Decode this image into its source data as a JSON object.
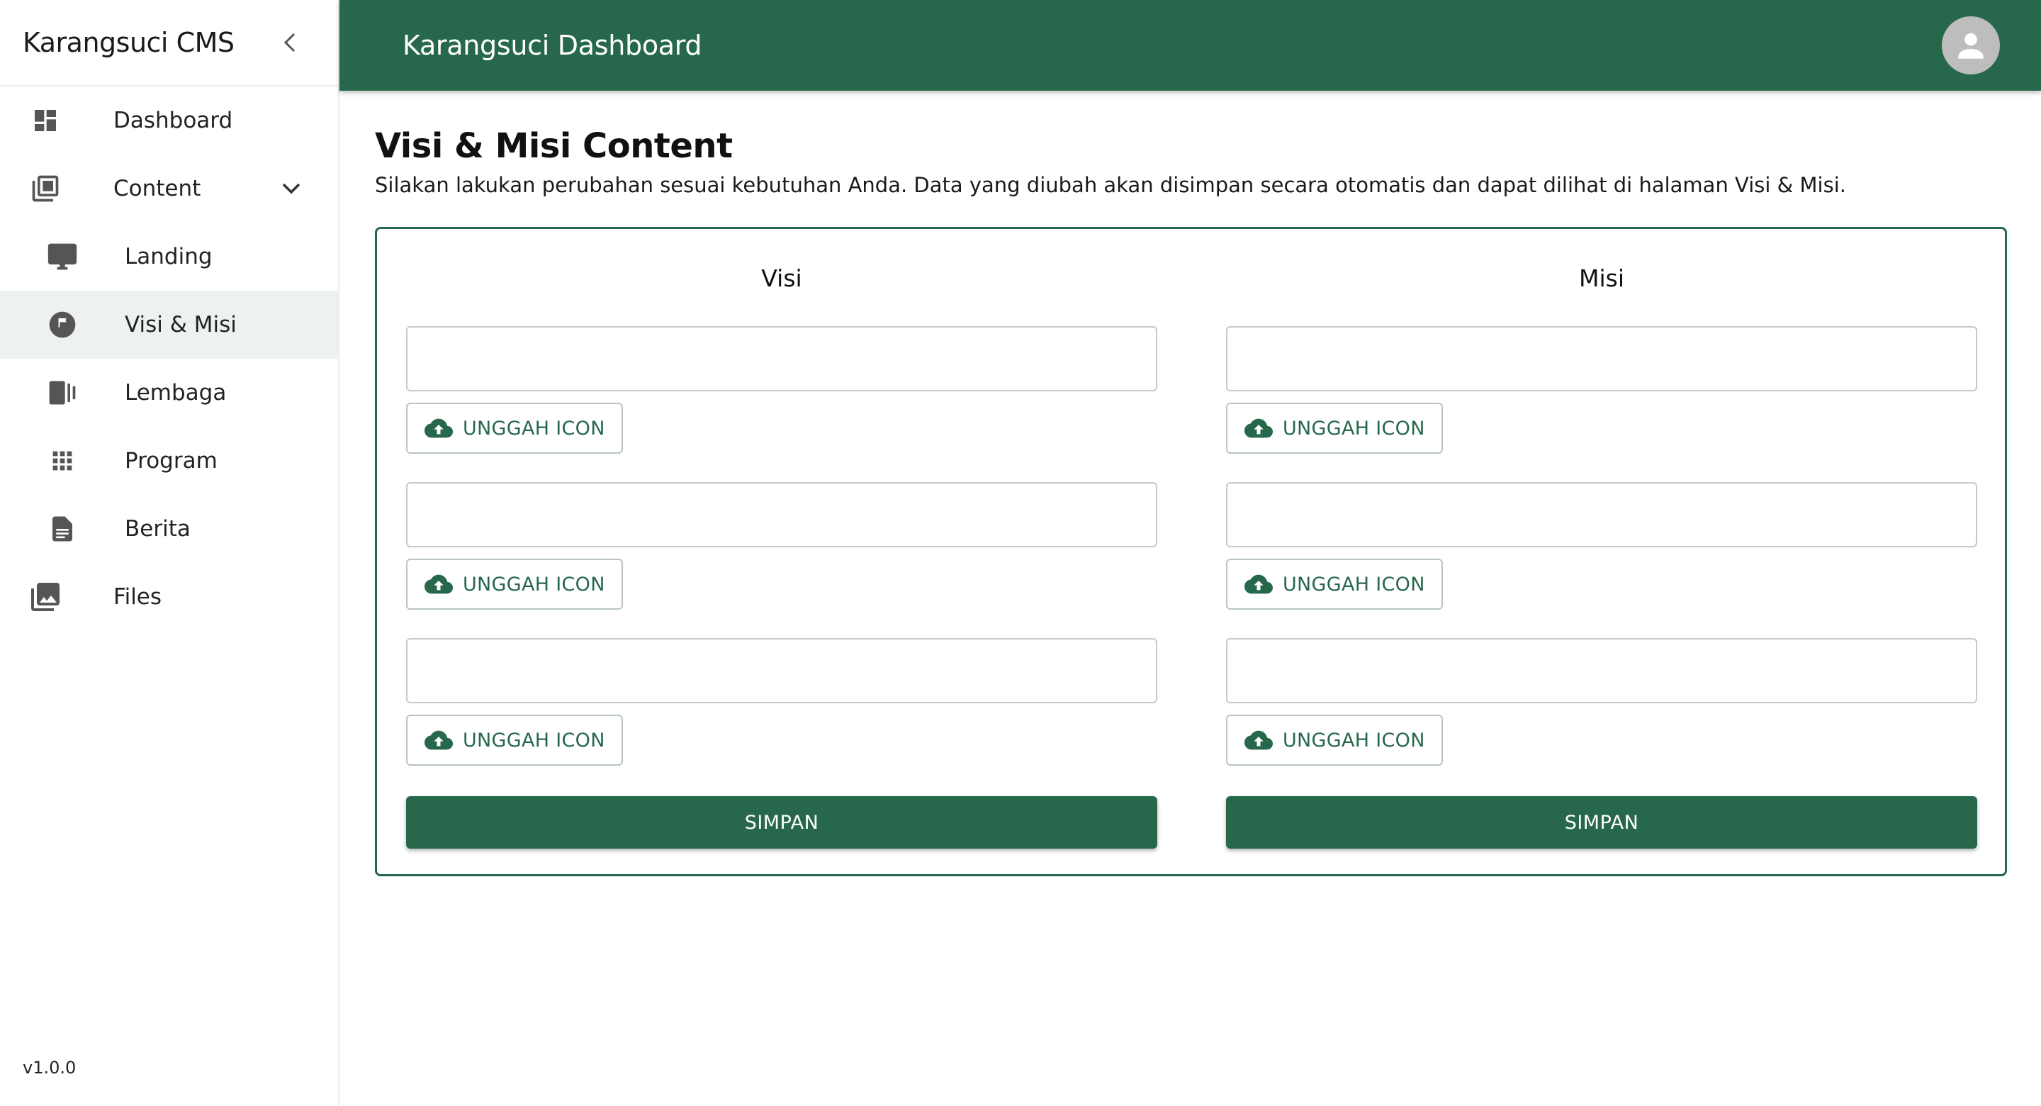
{
  "sidebar": {
    "brand": "Karangsuci CMS",
    "collapse_icon": "chevron-left-icon",
    "items": [
      {
        "label": "Dashboard",
        "icon": "dashboard-icon"
      },
      {
        "label": "Content",
        "icon": "library-icon",
        "expanded": true
      },
      {
        "label": "Landing",
        "icon": "monitor-icon"
      },
      {
        "label": "Visi & Misi",
        "icon": "flag-circle-icon",
        "active": true
      },
      {
        "label": "Lembaga",
        "icon": "building-panel-icon"
      },
      {
        "label": "Program",
        "icon": "apps-grid-icon"
      },
      {
        "label": "Berita",
        "icon": "article-icon"
      },
      {
        "label": "Files",
        "icon": "photo-library-icon"
      }
    ],
    "version": "v1.0.0"
  },
  "header": {
    "title": "Karangsuci Dashboard",
    "avatar_icon": "account-icon"
  },
  "main": {
    "title": "Visi & Misi Content",
    "description": "Silakan lakukan perubahan sesuai kebutuhan Anda. Data yang diubah akan disimpan secara otomatis dan dapat dilihat di halaman Visi & Misi.",
    "visi": {
      "title": "Visi",
      "fields": [
        "",
        "",
        ""
      ],
      "upload_label": "UNGGAH ICON",
      "save_label": "SIMPAN"
    },
    "misi": {
      "title": "Misi",
      "fields": [
        "",
        "",
        ""
      ],
      "upload_label": "UNGGAH ICON",
      "save_label": "SIMPAN"
    }
  },
  "colors": {
    "primary": "#27684c",
    "active_bg": "#edf2ef",
    "avatar_bg": "#bdbdbd"
  }
}
